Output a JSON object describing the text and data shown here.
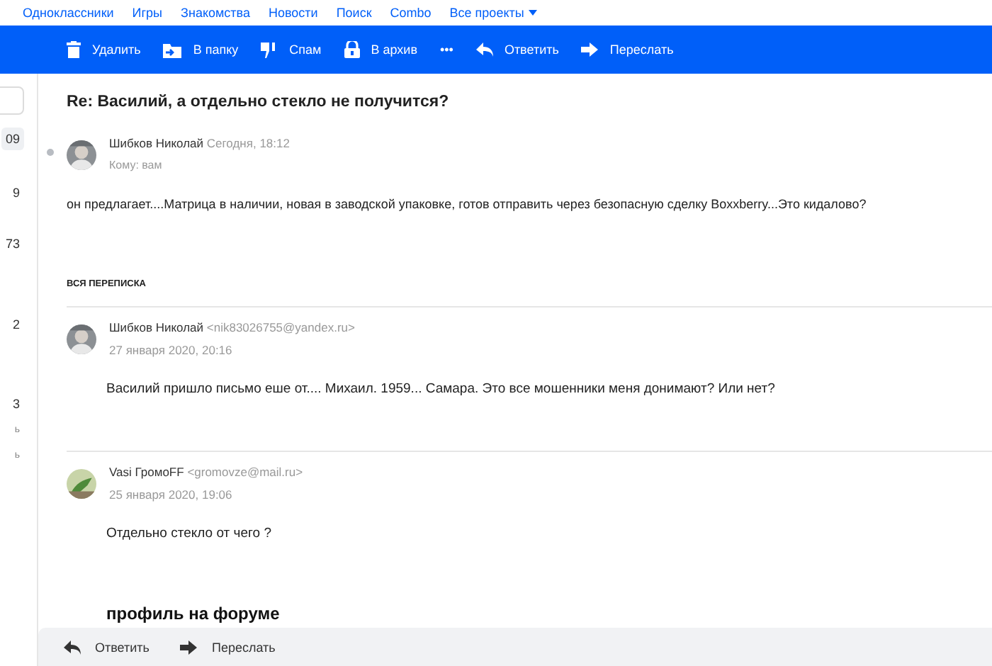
{
  "top_nav": {
    "items": [
      "Одноклассники",
      "Игры",
      "Знакомства",
      "Новости",
      "Поиск",
      "Combo",
      "Все проекты"
    ]
  },
  "toolbar": [
    {
      "kind": "trash",
      "label": "Удалить"
    },
    {
      "kind": "folder",
      "label": "В папку"
    },
    {
      "kind": "spam",
      "label": "Спам"
    },
    {
      "kind": "archive",
      "label": "В архив"
    },
    {
      "kind": "more",
      "label": "•••"
    },
    {
      "kind": "reply",
      "label": "Ответить"
    },
    {
      "kind": "forward",
      "label": "Переслать"
    }
  ],
  "sidebar": {
    "counts": [
      {
        "text": "09",
        "selected": true
      },
      {
        "text": "9",
        "selected": false
      },
      {
        "text": "73",
        "selected": false
      },
      {
        "text": "2",
        "selected": false
      },
      {
        "text": "3",
        "selected": false
      },
      {
        "text": "ь",
        "selected": false
      },
      {
        "text": "ь",
        "selected": false
      }
    ]
  },
  "message": {
    "subject": "Re: Василий, а отдельно стекло не получится?",
    "unread": true,
    "sender": "Шибков Николай",
    "time": "Сегодня, 18:12",
    "to": "Кому: вам",
    "body": "он предлагает....Матрица в наличии, новая в заводской упаковке, готов отправить через безопасную сделку Boxxberry...Это кидалово?"
  },
  "thread": {
    "title": "ВСЯ ПЕРЕПИСКА",
    "items": [
      {
        "sender": "Шибков Николай",
        "email": "<nik83026755@yandex.ru>",
        "date": "27 января 2020, 20:16",
        "body": "Василий пришло письмо еше от.... Михаил. 1959... Самара. Это все мошенники меня донимают? Или нет?"
      },
      {
        "sender": "Vasi ГромоFF",
        "email": "<gromovze@mail.ru>",
        "date": "25 января 2020, 19:06",
        "body": "Отдельно стекло от чего ?",
        "heading": "профиль на форуме"
      }
    ]
  },
  "footer": [
    {
      "kind": "reply",
      "label": "Ответить"
    },
    {
      "kind": "forward",
      "label": "Переслать"
    }
  ]
}
